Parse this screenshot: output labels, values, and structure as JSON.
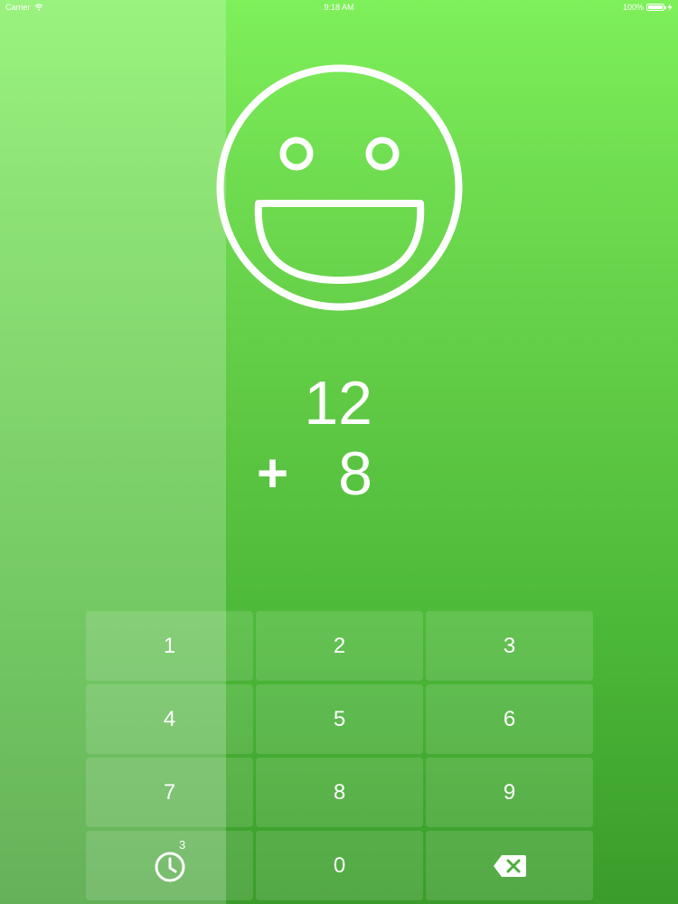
{
  "status_bar": {
    "carrier": "Carrier",
    "time": "9:18 AM",
    "battery": "100%",
    "battery_level": 1.0,
    "wifi_icon": "wifi-icon",
    "battery_icon": "battery-icon",
    "charging_icon": "charging-bolt-icon"
  },
  "feedback": {
    "icon": "smiley-face-icon",
    "mood": "happy"
  },
  "problem": {
    "top_number": "12",
    "operator": "+",
    "bottom_number": "8"
  },
  "keypad": {
    "keys": [
      "1",
      "2",
      "3",
      "4",
      "5",
      "6",
      "7",
      "8",
      "9"
    ],
    "zero": "0",
    "timer_icon": "timer-icon",
    "timer_badge": "3",
    "delete_icon": "backspace-icon"
  },
  "colors": {
    "background_top": "#7ef05a",
    "background_bottom": "#3a9c2a",
    "foreground": "#ffffff"
  }
}
